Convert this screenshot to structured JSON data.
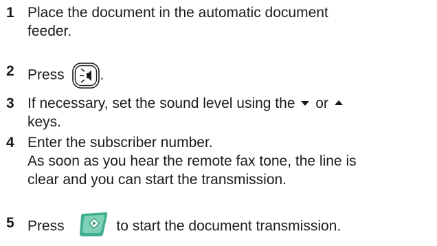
{
  "steps": [
    {
      "number": "1",
      "lines": [
        "Place the document in the automatic document",
        "feeder."
      ]
    },
    {
      "number": "2",
      "before": "Press",
      "after": ".",
      "icon": "speaker-button-icon"
    },
    {
      "number": "3",
      "line1_before": "If necessary, set the sound level using the",
      "line1_middle": "or",
      "line2": "keys.",
      "arrow_down": "down-arrow-icon",
      "arrow_up": "up-arrow-icon"
    },
    {
      "number": "4",
      "lines": [
        "Enter the subscriber number.",
        "As soon as you hear the remote fax tone, the line is",
        "clear and you can start the transmission."
      ]
    },
    {
      "number": "5",
      "before": "Press",
      "after": "to start the document transmission.",
      "icon": "start-button-icon"
    }
  ],
  "colors": {
    "text": "#1a1a1a",
    "start_button_green": "#3fae8f",
    "start_button_light": "#a8e2cf"
  }
}
